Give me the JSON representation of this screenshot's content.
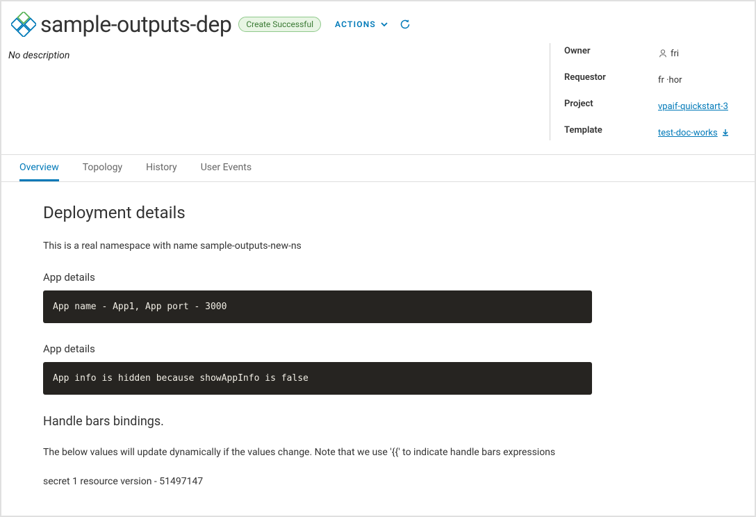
{
  "header": {
    "title": "sample-outputs-dep",
    "status_badge": "Create Successful",
    "actions_label": "ACTIONS",
    "description": "No description"
  },
  "meta": {
    "owner_label": "Owner",
    "owner_value": "fri",
    "requestor_label": "Requestor",
    "requestor_value": "fr                 ·hor",
    "project_label": "Project",
    "project_value": "vpaif-quickstart-3",
    "template_label": "Template",
    "template_value": "test-doc-works"
  },
  "tabs": {
    "overview": "Overview",
    "topology": "Topology",
    "history": "History",
    "user_events": "User Events"
  },
  "content": {
    "section_title": "Deployment details",
    "namespace_text": "This is a real namespace with name sample-outputs-new-ns",
    "app_details_heading_1": "App details",
    "code_block_1": "App name - App1, App port - 3000",
    "app_details_heading_2": "App details",
    "code_block_2": "App info is hidden because showAppInfo is false",
    "handlebars_title": "Handle bars bindings.",
    "handlebars_desc": "The below values will update dynamically if the values change. Note that we use '{{' to indicate handle bars expressions",
    "secret_line": "secret 1 resource version - 51497147"
  }
}
